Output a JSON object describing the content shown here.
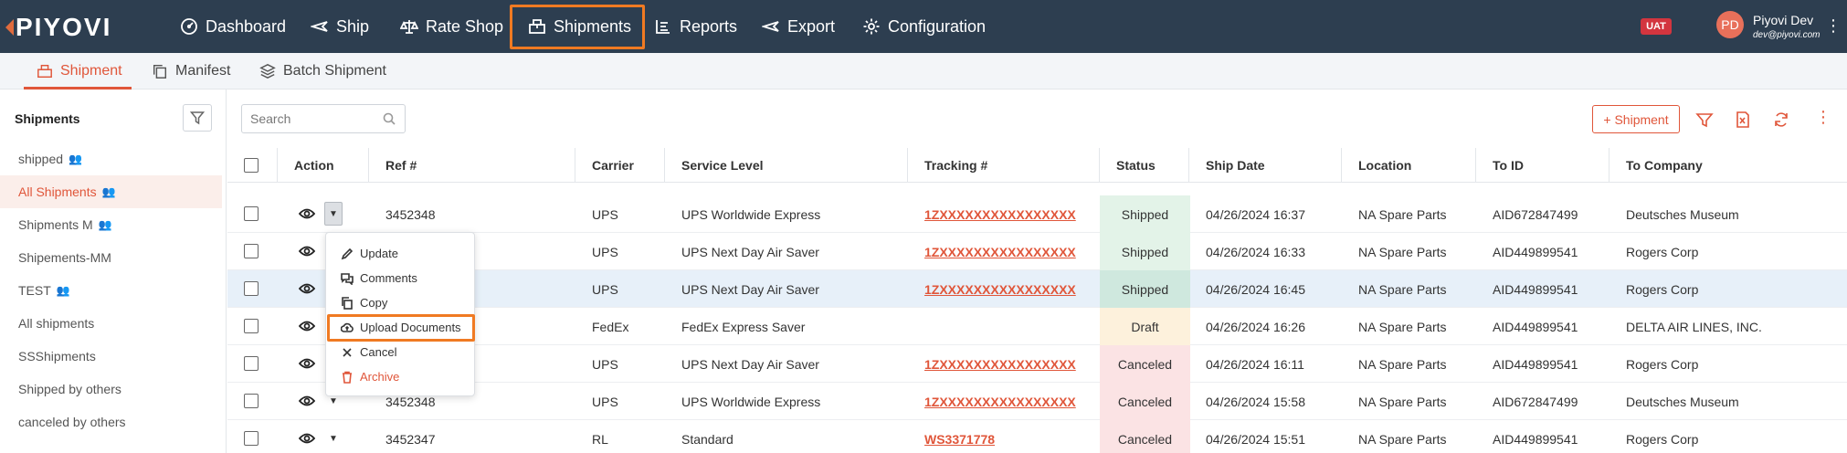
{
  "brand": {
    "logo_text": "PIYOVI",
    "accent": "#e0563a",
    "nav_bg": "#2d3e50",
    "highlight": "#f07a22"
  },
  "nav": {
    "items": [
      {
        "label": "Dashboard",
        "icon": "dashboard-icon"
      },
      {
        "label": "Ship",
        "icon": "ship-plane-icon"
      },
      {
        "label": "Rate Shop",
        "icon": "scale-icon"
      },
      {
        "label": "Shipments",
        "icon": "shipments-box-icon"
      },
      {
        "label": "Reports",
        "icon": "reports-chart-icon"
      },
      {
        "label": "Export",
        "icon": "export-plane-icon"
      },
      {
        "label": "Configuration",
        "icon": "gear-icon"
      }
    ],
    "env_badge": "UAT",
    "user_initials": "PD",
    "user_name": "Piyovi Dev",
    "user_email": "dev@piyovi.com"
  },
  "subtabs": [
    "Shipment",
    "Manifest",
    "Batch Shipment"
  ],
  "sidebar": {
    "title": "Shipments",
    "items": [
      {
        "label": "shipped",
        "group": true
      },
      {
        "label": "All Shipments",
        "group": true,
        "active": true
      },
      {
        "label": "Shipments M",
        "group": true
      },
      {
        "label": "Shipements-MM",
        "group": false
      },
      {
        "label": "TEST",
        "group": true
      },
      {
        "label": "All shipments",
        "group": false
      },
      {
        "label": "SSShipments",
        "group": false
      },
      {
        "label": "Shipped by others",
        "group": false
      },
      {
        "label": "canceled by others",
        "group": false
      }
    ]
  },
  "toolbar": {
    "search_placeholder": "Search",
    "add_label": "+ Shipment"
  },
  "table": {
    "columns": [
      "Action",
      "Ref #",
      "Carrier",
      "Service Level",
      "Tracking #",
      "Status",
      "Ship Date",
      "Location",
      "To ID",
      "To Company"
    ],
    "rows": [
      {
        "ref": "3452348",
        "carrier": "UPS",
        "service": "UPS Worldwide Express",
        "tracking": "1ZXXXXXXXXXXXXXXXX",
        "status": "Shipped",
        "date": "04/26/2024 16:37",
        "location": "NA Spare Parts",
        "to_id": "AID672847499",
        "company": "Deutsches Museum"
      },
      {
        "ref": "",
        "carrier": "UPS",
        "service": "UPS Next Day Air Saver",
        "tracking": "1ZXXXXXXXXXXXXXXXX",
        "status": "Shipped",
        "date": "04/26/2024 16:33",
        "location": "NA Spare Parts",
        "to_id": "AID449899541",
        "company": "Rogers Corp"
      },
      {
        "ref": "",
        "carrier": "UPS",
        "service": "UPS Next Day Air Saver",
        "tracking": "1ZXXXXXXXXXXXXXXXX",
        "status": "Shipped",
        "date": "04/26/2024 16:45",
        "location": "NA Spare Parts",
        "to_id": "AID449899541",
        "company": "Rogers Corp"
      },
      {
        "ref": "",
        "carrier": "FedEx",
        "service": "FedEx Express Saver",
        "tracking": "",
        "status": "Draft",
        "date": "04/26/2024 16:26",
        "location": "NA Spare Parts",
        "to_id": "AID449899541",
        "company": "DELTA AIR LINES, INC."
      },
      {
        "ref": "",
        "carrier": "UPS",
        "service": "UPS Next Day Air Saver",
        "tracking": "1ZXXXXXXXXXXXXXXXX",
        "status": "Canceled",
        "date": "04/26/2024 16:11",
        "location": "NA Spare Parts",
        "to_id": "AID449899541",
        "company": "Rogers Corp"
      },
      {
        "ref": "3452348",
        "carrier": "UPS",
        "service": "UPS Worldwide Express",
        "tracking": "1ZXXXXXXXXXXXXXXXX",
        "status": "Canceled",
        "date": "04/26/2024 15:58",
        "location": "NA Spare Parts",
        "to_id": "AID672847499",
        "company": "Deutsches Museum"
      },
      {
        "ref": "3452347",
        "carrier": "RL",
        "service": "Standard",
        "tracking": "WS3371778",
        "status": "Canceled",
        "date": "04/26/2024 15:51",
        "location": "NA Spare Parts",
        "to_id": "AID449899541",
        "company": "Rogers Corp"
      }
    ],
    "status_colors": {
      "Shipped": "#e3f3e8",
      "Draft": "#fdf1dc",
      "Canceled": "#fbe3e4"
    }
  },
  "action_menu": {
    "items": [
      {
        "label": "Update",
        "icon": "pencil-icon"
      },
      {
        "label": "Comments",
        "icon": "comments-icon"
      },
      {
        "label": "Copy",
        "icon": "copy-icon"
      },
      {
        "label": "Upload Documents",
        "icon": "cloud-upload-icon"
      },
      {
        "label": "Cancel",
        "icon": "close-icon"
      },
      {
        "label": "Archive",
        "icon": "trash-icon"
      }
    ]
  }
}
